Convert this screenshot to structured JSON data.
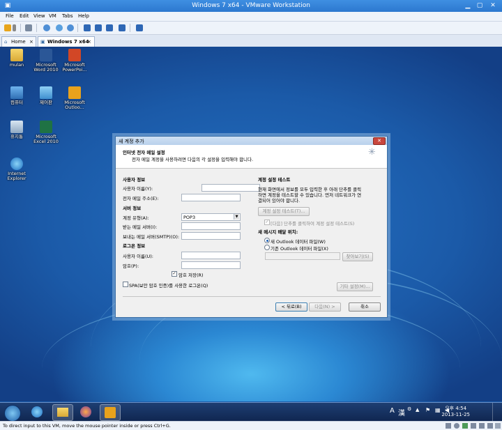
{
  "window": {
    "title": "Windows 7 x64 - VMware Workstation"
  },
  "menu": {
    "items": [
      "File",
      "Edit",
      "View",
      "VM",
      "Tabs",
      "Help"
    ]
  },
  "tabs": {
    "home": "Home",
    "vm": "Windows 7 x64"
  },
  "desktop_icons": {
    "mulan": "mulan",
    "word": [
      "Microsoft",
      "Word 2010"
    ],
    "powerpoint": [
      "Microsoft",
      "PowerPoi..."
    ],
    "computer": "컴퓨터",
    "control_panel": "제어판",
    "outlook": [
      "Microsoft",
      "Outloo..."
    ],
    "recycle_bin": "휴지통",
    "excel": [
      "Microsoft",
      "Excel 2010"
    ],
    "ie": [
      "Internet",
      "Explorer"
    ]
  },
  "dialog": {
    "title": "새 계정 추가",
    "header_title": "인터넷 전자 메일 설정",
    "header_subtitle": "전자 메일 계정을 사용하려면 다음의 각 설정을 입력해야 합니다.",
    "user_info": {
      "heading": "사용자 정보",
      "name_label": "사용자 이름(Y):",
      "email_label": "전자 메일 주소(E):"
    },
    "server_info": {
      "heading": "서버 정보",
      "account_type_label": "계정 유형(A):",
      "account_type_value": "POP3",
      "incoming_label": "받는 메일 서버(I):",
      "outgoing_label": "보내는 메일 서버(SMTP)(O):"
    },
    "logon_info": {
      "heading": "로그온 정보",
      "username_label": "사용자 이름(U):",
      "password_label": "암호(P):",
      "remember_password": "암호 저장(R)",
      "spa_label": "SPA(보안 암호 인증)를 사용한 로그온(Q)"
    },
    "test": {
      "heading": "계정 설정 테스트",
      "description": [
        "현재 화면에서 정보를 모두 입력한 후 아래 단추를 클릭",
        "하면 계정을 테스트할 수 있습니다. 먼저 네트워크가 연",
        "결되어 있어야 합니다."
      ],
      "test_button": "계정 설정 테스트(T)...",
      "next_test_label": "[다음] 단추를 클릭하여 계정 설정 테스트(S)"
    },
    "deliver": {
      "heading": "새 메시지 배달 위치:",
      "new_file": "새 Outlook 데이터 파일(W)",
      "existing_file": "기존 Outlook 데이터 파일(X)",
      "browse": "찾아보기(S)"
    },
    "more_settings": "기타 설정(M)...",
    "back": "< 뒤로(B)",
    "next": "다음(N) >",
    "cancel": "취소"
  },
  "taskbar": {
    "ime_mode": "A",
    "ime_hanja": "漢",
    "time": "오후 4:54",
    "date": "2013-11-25"
  },
  "status": "To direct input to this VM, move the mouse pointer inside or press Ctrl+G."
}
